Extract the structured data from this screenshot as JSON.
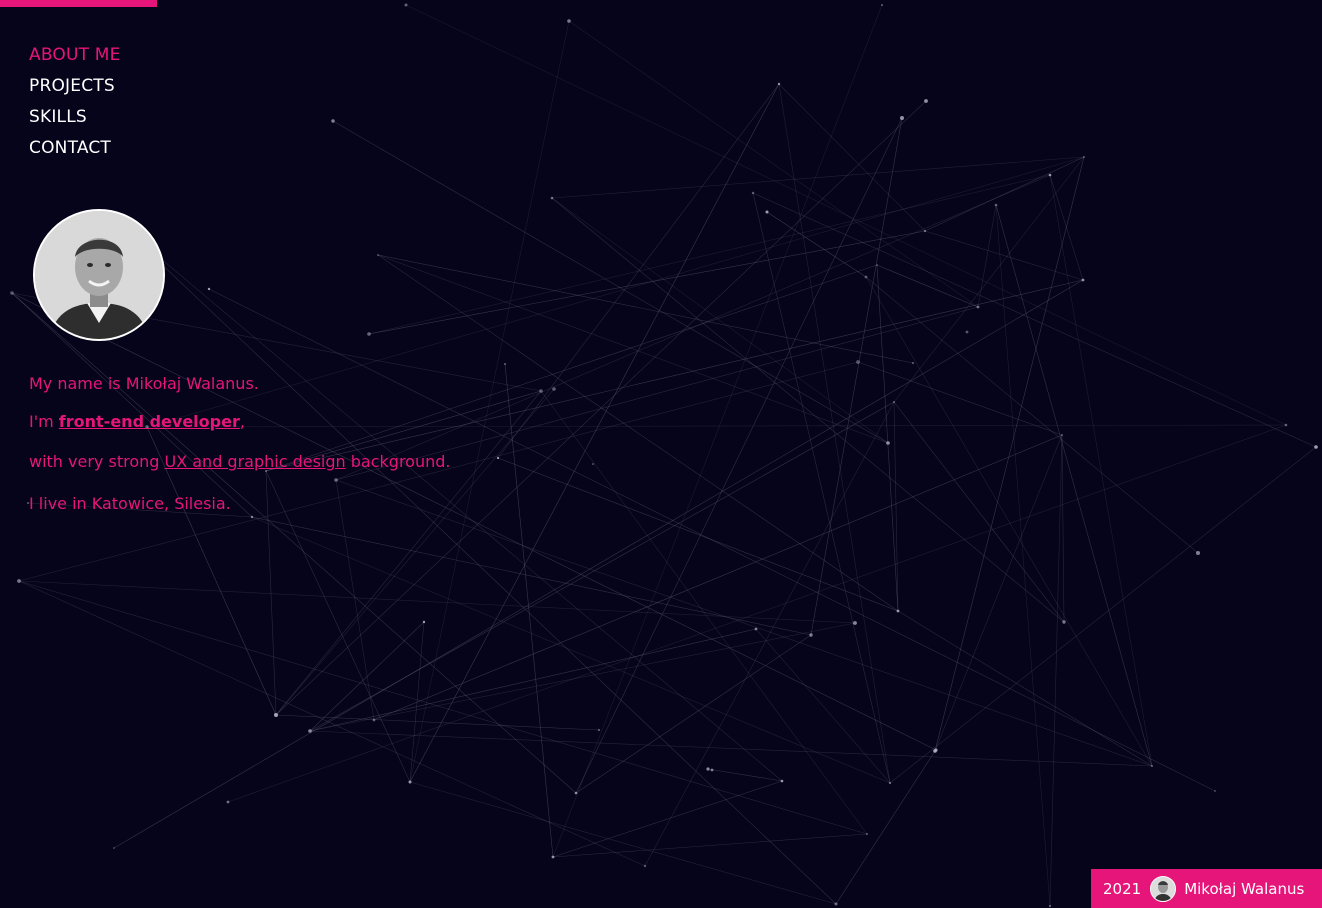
{
  "nav": {
    "items": [
      {
        "label": "ABOUT ME",
        "active": true
      },
      {
        "label": "PROJECTS",
        "active": false
      },
      {
        "label": "SKILLS",
        "active": false
      },
      {
        "label": "CONTACT",
        "active": false
      }
    ]
  },
  "bio": {
    "line1": "My name is Mikołaj Walanus.",
    "line2_prefix": "I'm ",
    "line2_link": "front-end developer",
    "line2_suffix": ",",
    "line3_prefix": "with very strong ",
    "line3_link": "UX and graphic design",
    "line3_suffix": " background.",
    "line4": "I live in Katowice, Silesia."
  },
  "footer": {
    "year": "2021",
    "name": "Mikołaj Walanus"
  },
  "colors": {
    "accent": "#e6157a",
    "background": "#06041a",
    "text": "#ffffff"
  },
  "icons": {
    "avatar": "profile-photo",
    "footer_avatar": "profile-photo-small"
  }
}
